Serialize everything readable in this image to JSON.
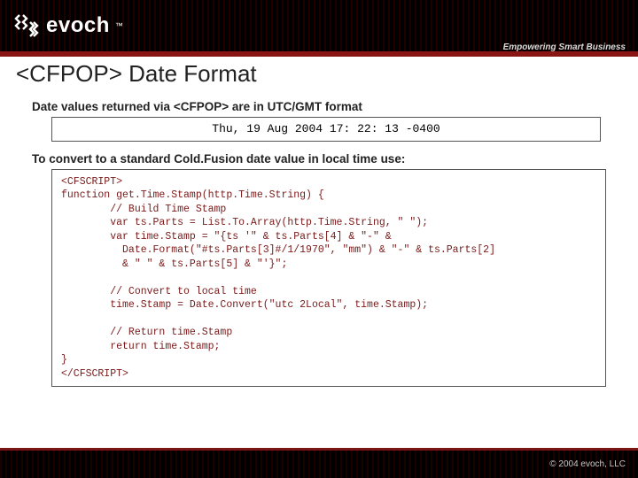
{
  "header": {
    "brand_name": "evoch",
    "tagline": "Empowering Smart Business"
  },
  "title": "<CFPOP> Date Format",
  "lead1": "Date values returned via <CFPOP> are in UTC/GMT format",
  "date_example": "Thu, 19 Aug 2004 17: 22: 13 -0400",
  "lead2": "To convert to a standard Cold.Fusion date value in local time use:",
  "code": "<CFSCRIPT>\nfunction get.Time.Stamp(http.Time.String) {\n        // Build Time Stamp\n        var ts.Parts = List.To.Array(http.Time.String, \" \");\n        var time.Stamp = \"{ts '\" & ts.Parts[4] & \"-\" &\n          Date.Format(\"#ts.Parts[3]#/1/1970\", \"mm\") & \"-\" & ts.Parts[2]\n          & \" \" & ts.Parts[5] & \"'}\";\n\n        // Convert to local time\n        time.Stamp = Date.Convert(\"utc 2Local\", time.Stamp);\n\n        // Return time.Stamp\n        return time.Stamp;\n}\n</CFSCRIPT>",
  "footer": {
    "copyright": "© 2004 evoch, LLC"
  }
}
